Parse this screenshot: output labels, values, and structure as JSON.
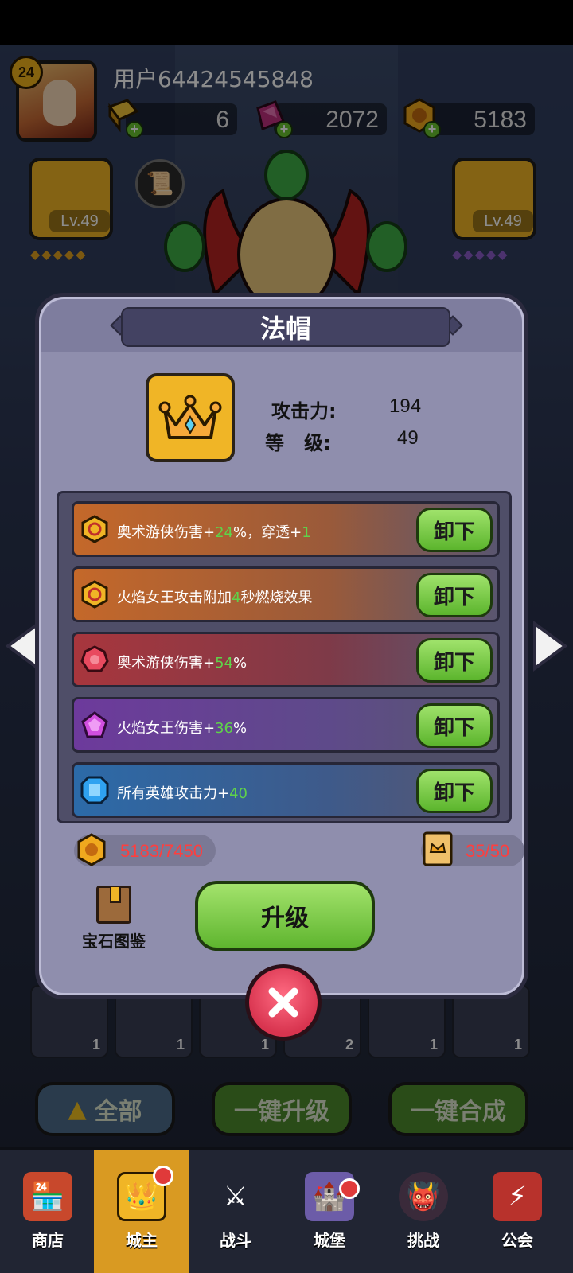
{
  "header": {
    "player_level": "24",
    "username": "用户64424545848",
    "resources": [
      {
        "name": "gold-bar",
        "value": "6"
      },
      {
        "name": "purple-gem",
        "value": "2072"
      },
      {
        "name": "gold-coin",
        "value": "5183"
      }
    ],
    "left_card_level": "Lv.49",
    "right_card_level": "Lv.49"
  },
  "modal": {
    "title": "法帽",
    "stats": {
      "attack_label": "攻击力:",
      "attack_value": "194",
      "level_label": "等   级:",
      "level_value": "49"
    },
    "effects": [
      {
        "icon": "hex-rune-gold-icon",
        "pre": "奥术游侠伤害+",
        "num1": "24",
        "mid": "%，穿透+",
        "num2": "1",
        "post": "",
        "button": "卸下",
        "bg": "#c4682a"
      },
      {
        "icon": "hex-rune-gold-icon",
        "pre": "火焰女王攻击附加",
        "num1": "4",
        "mid": "秒燃烧效果",
        "num2": "",
        "post": "",
        "button": "卸下",
        "bg": "#c4682a"
      },
      {
        "icon": "red-gem-icon",
        "pre": "奥术游侠伤害+",
        "num1": "54",
        "mid": "%",
        "num2": "",
        "post": "",
        "button": "卸下",
        "bg": "#a8363d"
      },
      {
        "icon": "purple-gem-icon",
        "pre": "火焰女王伤害+",
        "num1": "36",
        "mid": "%",
        "num2": "",
        "post": "",
        "button": "卸下",
        "bg": "#6d3a9c"
      },
      {
        "icon": "blue-gem-icon",
        "pre": "所有英雄攻击力+",
        "num1": "40",
        "mid": "",
        "num2": "",
        "post": "",
        "button": "卸下",
        "bg": "#2c6aa8"
      }
    ],
    "gold_cost": "5183/7450",
    "scroll_cost": "35/50",
    "gem_book_label": "宝石图鉴",
    "upgrade_label": "升级"
  },
  "bottom_actions": {
    "all": "全部",
    "one_click_upgrade": "一键升级",
    "one_click_merge": "一键合成"
  },
  "inventory_counts": [
    "1",
    "1",
    "1",
    "2",
    "1",
    "1"
  ],
  "nav": [
    {
      "label": "商店",
      "icon": "shop-icon",
      "active": false,
      "dot": false
    },
    {
      "label": "城主",
      "icon": "lord-icon",
      "active": true,
      "dot": true
    },
    {
      "label": "战斗",
      "icon": "swords-icon",
      "active": false,
      "dot": false
    },
    {
      "label": "城堡",
      "icon": "castle-icon",
      "active": false,
      "dot": true
    },
    {
      "label": "挑战",
      "icon": "demon-icon",
      "active": false,
      "dot": false
    },
    {
      "label": "公会",
      "icon": "guild-banner-icon",
      "active": false,
      "dot": false
    }
  ],
  "colors": {
    "accent_green": "#5fd34a",
    "cost_red": "#ff3e3e",
    "modal_bg": "#8f8ead",
    "gold": "#f0b526"
  }
}
